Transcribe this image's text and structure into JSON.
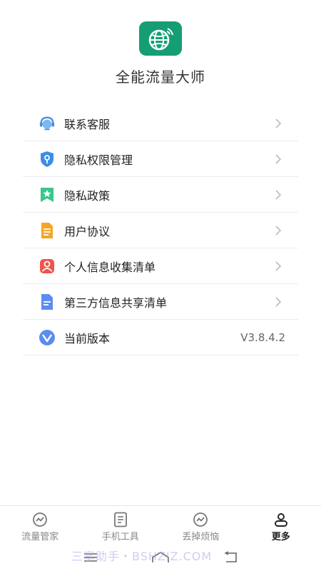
{
  "app": {
    "title": "全能流量大师",
    "brand_color": "#159e74"
  },
  "menu": {
    "items": [
      {
        "label": "联系客服",
        "icon": "customer-service-icon",
        "color": "#4a90e2"
      },
      {
        "label": "隐私权限管理",
        "icon": "privacy-shield-icon",
        "color": "#3a8ee6"
      },
      {
        "label": "隐私政策",
        "icon": "policy-bookmark-icon",
        "color": "#3cc58c"
      },
      {
        "label": "用户协议",
        "icon": "agreement-document-icon",
        "color": "#f5a623"
      },
      {
        "label": "个人信息收集清单",
        "icon": "personal-info-icon",
        "color": "#f0544a"
      },
      {
        "label": "第三方信息共享清单",
        "icon": "third-party-doc-icon",
        "color": "#5b8def"
      }
    ],
    "version": {
      "label": "当前版本",
      "value": "V3.8.4.2",
      "icon": "version-v-icon",
      "color": "#5b8def"
    }
  },
  "tabs": [
    {
      "label": "流量管家",
      "icon": "traffic-gauge-icon",
      "active": false
    },
    {
      "label": "手机工具",
      "icon": "tools-list-icon",
      "active": false
    },
    {
      "label": "丢掉烦恼",
      "icon": "relax-gauge-icon",
      "active": false
    },
    {
      "label": "更多",
      "icon": "more-person-icon",
      "active": true
    }
  ],
  "watermark": "三享助手・BSHZIZ.COM"
}
